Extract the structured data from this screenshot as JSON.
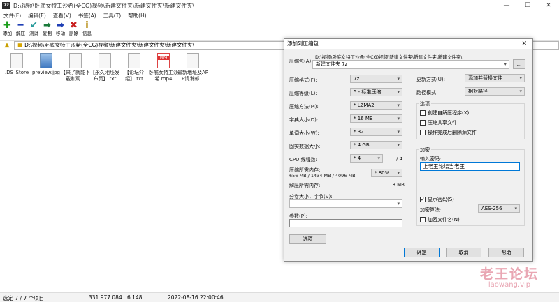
{
  "window": {
    "app_icon": "7z",
    "title": "D:\\视频\\卧底女特工沙希(全CG)视频\\新建文件夹\\新建文件夹\\新建文件夹\\",
    "controls": [
      "—",
      "☐",
      "✕"
    ]
  },
  "menu": [
    "文件(F)",
    "编辑(E)",
    "查看(V)",
    "书签(A)",
    "工具(T)",
    "帮助(H)"
  ],
  "toolbar": [
    {
      "label": "添加",
      "icon": "plus-icon",
      "glyph": "✚",
      "color": "#1a9e1a"
    },
    {
      "label": "解压",
      "icon": "minus-icon",
      "glyph": "━",
      "color": "#1f3fb5"
    },
    {
      "label": "测试",
      "icon": "check-icon",
      "glyph": "✔",
      "color": "#2a9b9b"
    },
    {
      "label": "复制",
      "icon": "copy-arrow-icon",
      "glyph": "➡",
      "color": "#1a7a3a"
    },
    {
      "label": "移动",
      "icon": "move-arrow-icon",
      "glyph": "➡",
      "color": "#1f3fb5"
    },
    {
      "label": "删除",
      "icon": "delete-icon",
      "glyph": "✖",
      "color": "#c81e1e"
    },
    {
      "label": "信息",
      "icon": "info-icon",
      "glyph": "i",
      "color": "#b08400"
    }
  ],
  "address": "D:\\视频\\卧底女特工沙希(全CG)视频\\新建文件夹\\新建文件夹\\新建文件夹\\",
  "files": [
    {
      "name": ".DS_Store",
      "type": "doc"
    },
    {
      "name": "preview.jpg",
      "type": "img"
    },
    {
      "name": "【来了就能下载和观...",
      "type": "doc"
    },
    {
      "name": "【永久地址发布页】.txt",
      "type": "doc"
    },
    {
      "name": "【论坛介绍】.txt",
      "type": "doc"
    },
    {
      "name": "卧底女特工沙希.mp4",
      "type": "mp4"
    },
    {
      "name": "最新地址及APP请发邮...",
      "type": "doc"
    }
  ],
  "status": {
    "selection": "选定 7 / 7 个项目",
    "size": "331 977 084",
    "packed": "6 148",
    "modified": "2022-08-16 22:00:46"
  },
  "dialog": {
    "title": "添加到压缩包",
    "archive_label": "压缩包(A):",
    "archive_path": "D:\\视频\\卧底女特工沙希(全CG)视频\\新建文件夹\\新建文件夹\\新建文件夹\\",
    "archive_name": "新建文件夹 7z",
    "browse": "...",
    "format_label": "压缩格式(F):",
    "format": "7z",
    "level_label": "压缩等级(L):",
    "level": "5 - 标准压缩",
    "method_label": "压缩方法(M):",
    "method": "* LZMA2",
    "dict_label": "字典大小(D):",
    "dict": "* 16 MB",
    "word_label": "单词大小(W):",
    "word": "* 32",
    "solid_label": "固实数据大小:",
    "solid": "* 4 GB",
    "threads_label": "CPU 线程数:",
    "threads": "* 4",
    "threads_max": "/ 4",
    "mem_label": "压缩所需内存:",
    "mem_detail": "656 MB / 1434 MB / 4096 MB",
    "mem_pct": "* 80%",
    "dmem_label": "解压所需内存:",
    "dmem": "18 MB",
    "split_label": "分卷大小，字节(V):",
    "params_label": "参数(P):",
    "options_btn": "选项",
    "update_label": "更新方式(U):",
    "update": "添加并替换文件",
    "path_label": "路径模式",
    "path": "相对路径",
    "opts_group": "选项",
    "opt_sfx": "创建自解压程序(X)",
    "opt_shared": "压缩共享文件",
    "opt_delete": "操作完成后删除源文件",
    "enc_group": "加密",
    "pwd_label": "输入密码:",
    "pwd": "上老王论坛当老王",
    "show_pwd": "显示密码(S)",
    "enc_method_label": "加密算法:",
    "enc_method": "AES-256",
    "enc_names": "加密文件名(N)",
    "ok": "确定",
    "cancel": "取消",
    "help": "帮助"
  },
  "watermark": {
    "line1": "老王论坛",
    "line2": "laowang.vip"
  }
}
